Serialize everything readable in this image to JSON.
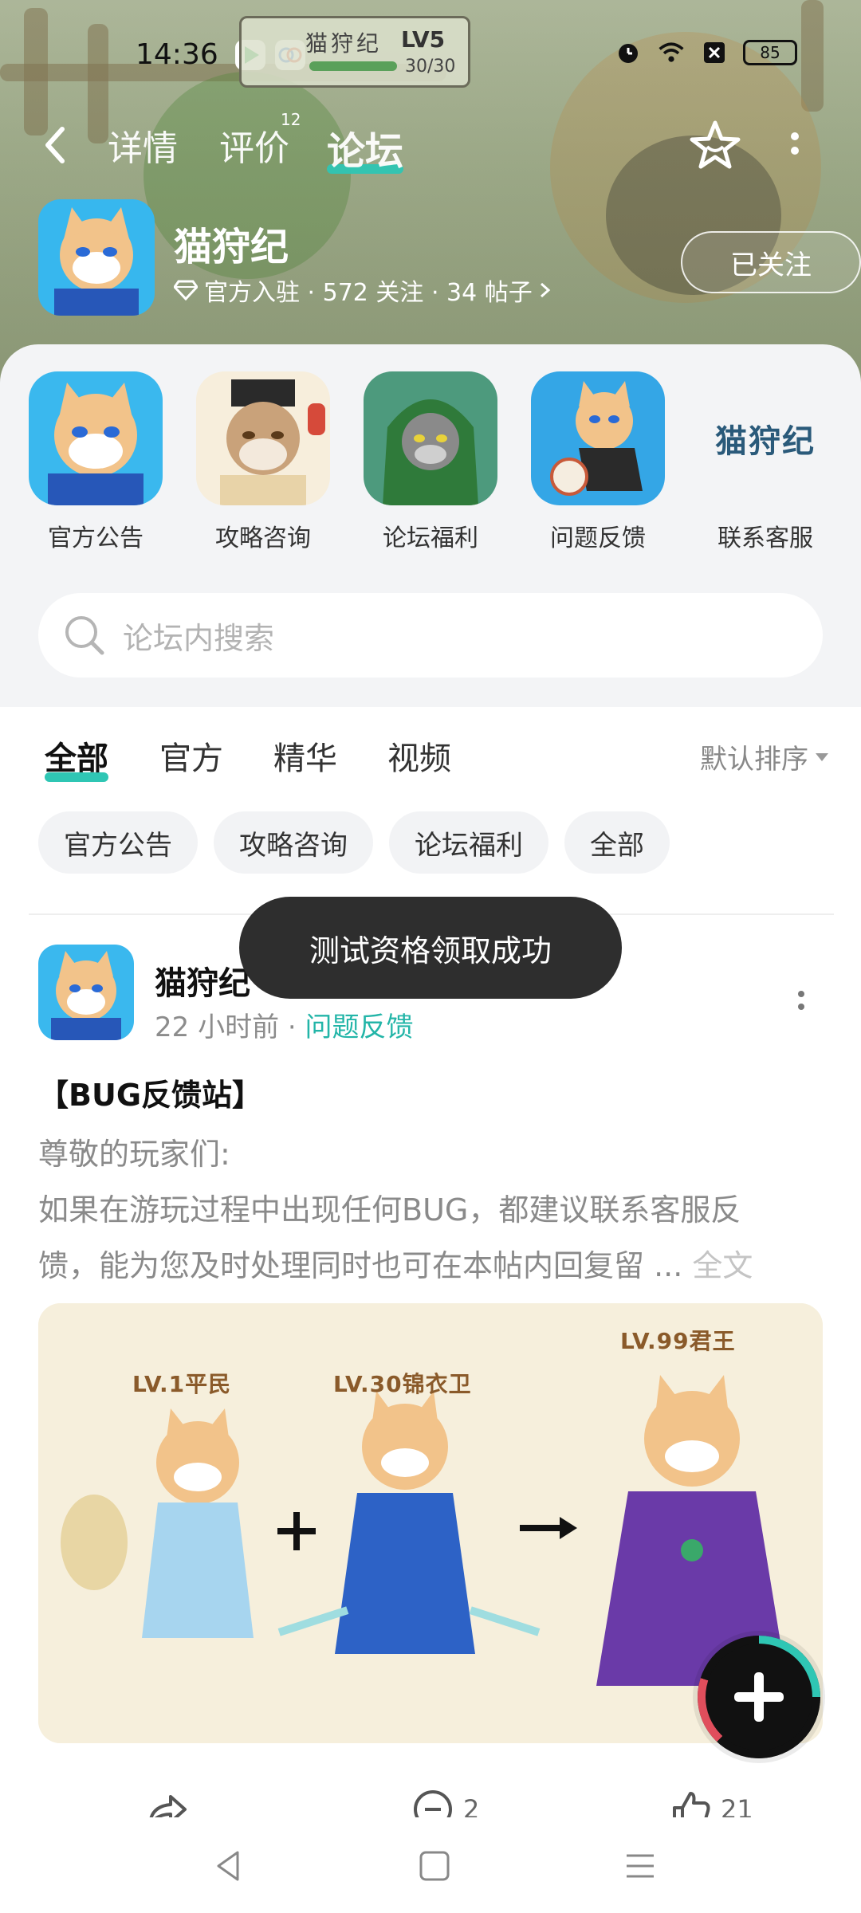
{
  "status_bar": {
    "time": "14:36",
    "game_badge": {
      "title": "猫狩纪",
      "level": "LV5",
      "progress": "30/30"
    },
    "battery": "85"
  },
  "header": {
    "back_icon": "chevron-left-icon",
    "tabs": [
      {
        "label": "详情",
        "active": false
      },
      {
        "label": "评价",
        "active": false,
        "count": "12"
      },
      {
        "label": "论坛",
        "active": true
      }
    ],
    "star_icon": "star-icon",
    "more_icon": "more-vertical-icon"
  },
  "game": {
    "name": "猫狩纪",
    "meta": "官方入驻 · 572 关注 · 34 帖子",
    "follow_label": "已关注"
  },
  "quick_links": [
    {
      "label": "官方公告",
      "icon": "cat-blue-robe-icon"
    },
    {
      "label": "攻略咨询",
      "icon": "cat-minister-icon"
    },
    {
      "label": "论坛福利",
      "icon": "cat-green-hood-icon"
    },
    {
      "label": "问题反馈",
      "icon": "cat-fighter-icon"
    },
    {
      "label": "联系客服",
      "icon": "brand-logo",
      "logo_text": "猫狩纪"
    }
  ],
  "search": {
    "placeholder": "论坛内搜索"
  },
  "feed_tabs": [
    {
      "label": "全部",
      "active": true
    },
    {
      "label": "官方",
      "active": false
    },
    {
      "label": "精华",
      "active": false
    },
    {
      "label": "视频",
      "active": false
    }
  ],
  "sort_label": "默认排序",
  "chips": [
    "官方公告",
    "攻略咨询",
    "论坛福利",
    "全部"
  ],
  "post": {
    "author": "猫狩纪",
    "time": "22 小时前",
    "separator": "·",
    "category": "问题反馈",
    "title": "【BUG反馈站】",
    "body_lines": [
      "尊敬的玩家们:",
      " 如果在游玩过程中出现任何BUG，都建议联系客服反",
      "馈，能为您及时处理同时也可在本帖内回复留 ..."
    ],
    "fulltext_label": "全文",
    "banner": {
      "labels": [
        "LV.1平民",
        "LV.30锦衣卫",
        "LV.99君王"
      ]
    },
    "actions": {
      "share": "",
      "comments": "2",
      "likes": "21"
    }
  },
  "toast": "测试资格领取成功",
  "colors": {
    "accent": "#2fc6b4",
    "category": "#23b5a8"
  }
}
